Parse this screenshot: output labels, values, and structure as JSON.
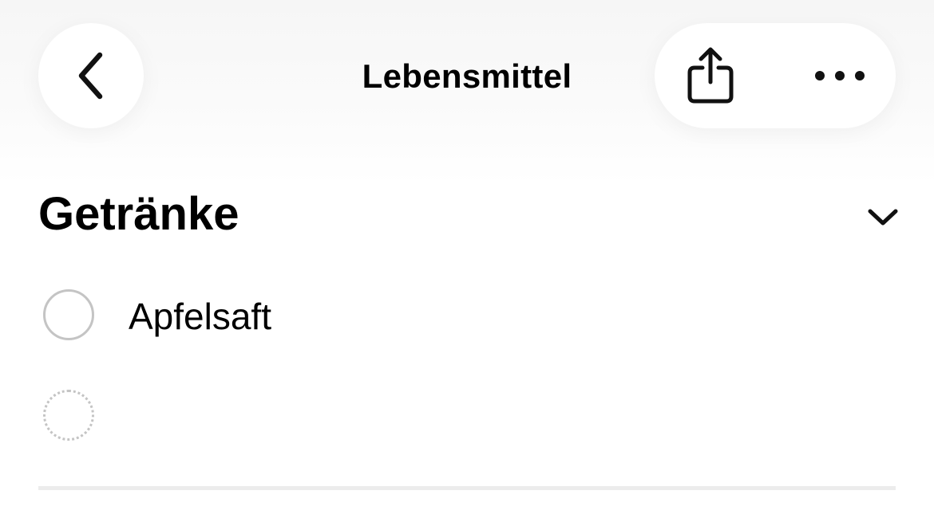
{
  "nav": {
    "title": "Lebensmittel",
    "back_icon": "chevron-left-icon",
    "share_icon": "share-icon",
    "more_icon": "ellipsis-icon"
  },
  "section": {
    "title": "Getränke",
    "collapse_icon": "chevron-down-icon"
  },
  "items": [
    {
      "label": "Apfelsaft",
      "checked": false
    },
    {
      "label": "",
      "checked": false,
      "placeholder_row": true
    }
  ],
  "colors": {
    "text": "#000000",
    "checkbox_border": "#c4c4c4",
    "divider": "#ececec",
    "button_bg": "#ffffff"
  }
}
